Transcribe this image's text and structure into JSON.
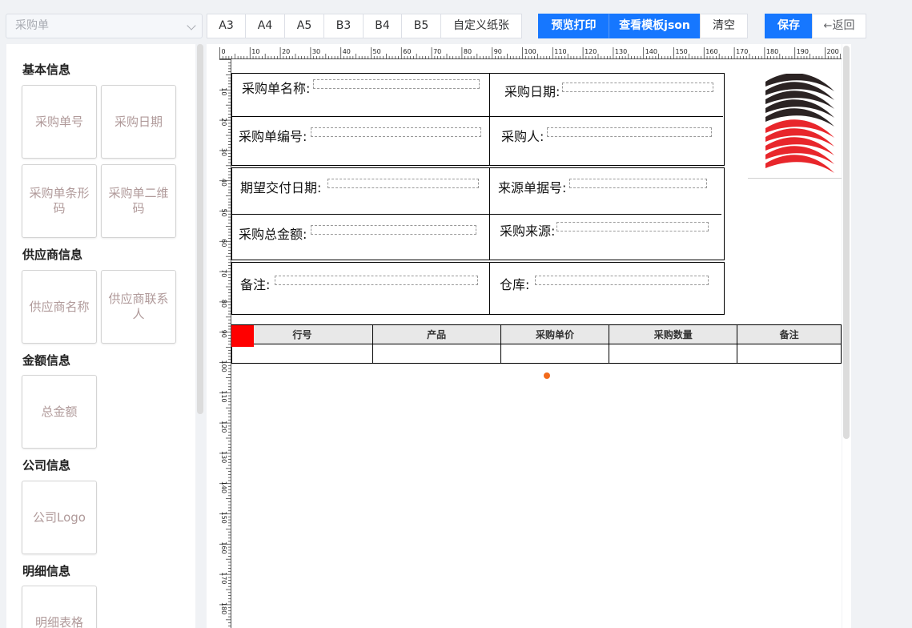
{
  "toolbar": {
    "template_placeholder": "采购单",
    "paper_sizes": [
      "A3",
      "A4",
      "A5",
      "B3",
      "B4",
      "B5",
      "自定义纸张"
    ],
    "preview_label": "预览打印",
    "view_json_label": "查看模板json",
    "clear_label": "清空",
    "save_label": "保存",
    "back_label": "返回"
  },
  "sidebar": {
    "groups": [
      {
        "title": "基本信息",
        "items": [
          "采购单号",
          "采购日期",
          "采购单条形码",
          "采购单二维码"
        ]
      },
      {
        "title": "供应商信息",
        "items": [
          "供应商名称",
          "供应商联系人"
        ]
      },
      {
        "title": "金额信息",
        "items": [
          "总金额"
        ]
      },
      {
        "title": "公司信息",
        "items": [
          "公司Logo"
        ]
      },
      {
        "title": "明细信息",
        "items": [
          "明细表格"
        ]
      }
    ]
  },
  "ruler": {
    "h_labels": [
      "0",
      "10",
      "20",
      "30",
      "40",
      "50",
      "60",
      "70",
      "80",
      "90",
      "100",
      "110",
      "120",
      "130",
      "140",
      "150",
      "160",
      "170",
      "180",
      "190",
      "200"
    ],
    "v_labels": [
      "10",
      "20",
      "30",
      "40",
      "50",
      "60",
      "70",
      "80",
      "90",
      "100",
      "110",
      "120",
      "130",
      "140",
      "150",
      "160",
      "170",
      "180"
    ]
  },
  "form": {
    "name_label": "采购单名称:",
    "date_label": "采购日期:",
    "number_label": "采购单编号:",
    "buyer_label": "采购人:",
    "delivery_label": "期望交付日期:",
    "source_no_label": "来源单据号:",
    "amount_label": "采购总金额:",
    "source_label": "采购来源:",
    "remark_label": "备注:",
    "warehouse_label": "仓库:"
  },
  "detail_table": {
    "headers": [
      "行号",
      "产品",
      "采购单价",
      "采购数量",
      "备注"
    ]
  },
  "colors": {
    "primary": "#1677ff",
    "handle_red": "#ff0000",
    "dot_orange": "#f26a1b",
    "logo_dark": "#2b2323",
    "logo_red": "#e8262b"
  }
}
